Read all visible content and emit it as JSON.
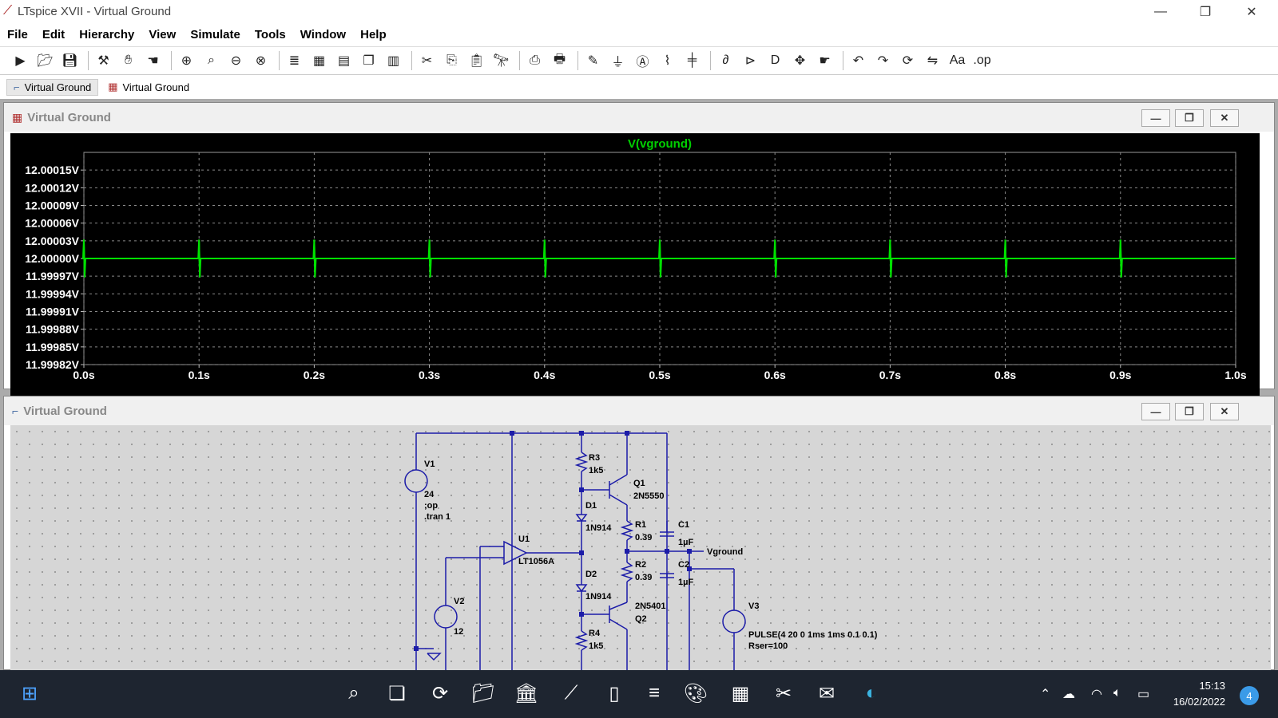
{
  "window": {
    "title": "LTspice XVII - Virtual Ground",
    "minimize": "—",
    "maximize": "❐",
    "close": "✕"
  },
  "menu": [
    "File",
    "Edit",
    "Hierarchy",
    "View",
    "Simulate",
    "Tools",
    "Window",
    "Help"
  ],
  "toolbar_icons": [
    "run-icon",
    "open-icon",
    "save-icon",
    "control-panel-icon",
    "halt-icon",
    "pan-hand-icon",
    "zoom-in-icon",
    "zoom-area-icon",
    "zoom-out-icon",
    "zoom-fit-icon",
    "autorange-icon",
    "grid-icon",
    "tile-horizontal-icon",
    "cascade-icon",
    "tile-vertical-icon",
    "cut-icon",
    "copy-icon",
    "paste-icon",
    "find-icon",
    "print-setup-icon",
    "print-icon",
    "wire-icon",
    "ground-icon",
    "label-net-icon",
    "resistor-icon",
    "capacitor-icon",
    "inductor-icon",
    "diode-icon",
    "component-icon",
    "move-icon",
    "drag-icon",
    "undo-icon",
    "redo-icon",
    "rotate-icon",
    "mirror-icon",
    "text-icon",
    "spice-directive-icon"
  ],
  "doc_tabs": [
    {
      "label": "Virtual Ground",
      "icon": "schematic-icon"
    },
    {
      "label": "Virtual Ground",
      "icon": "waveform-icon"
    }
  ],
  "plot_window": {
    "title": "Virtual Ground",
    "trace_label": "V(vground)"
  },
  "schematic_window": {
    "title": "Virtual Ground"
  },
  "schematic": {
    "labels": {
      "v1": "V1",
      "v1_value": "24",
      "op": ";op",
      "tran": ".tran 1",
      "v2": "V2",
      "v2_value": "12",
      "u1": "U1",
      "u1_part": "LT1056A",
      "r3": "R3",
      "r3_value": "1k5",
      "q1": "Q1",
      "q1_part": "2N5550",
      "d1": "D1",
      "d1_part": "1N914",
      "r1": "R1",
      "r1_value": "0.39",
      "c1": "C1",
      "c1_value": "1µF",
      "r2": "R2",
      "r2_value": "0.39",
      "c2": "C2",
      "c2_value": "1µF",
      "d2": "D2",
      "d2_part": "1N914",
      "q2_part": "2N5401",
      "q2": "Q2",
      "r4": "R4",
      "r4_value": "1k5",
      "net_vground": "Vground",
      "v3": "V3",
      "v3_pulse": "PULSE(4 20 0 1ms 1ms 0.1 0.1)",
      "v3_rser": "Rser=100"
    }
  },
  "chart_data": {
    "type": "line",
    "title": "V(vground)",
    "xlabel": "",
    "ylabel": "",
    "xlim": [
      0.0,
      1.0
    ],
    "ylim": [
      11.99982,
      12.00018
    ],
    "x_ticks": [
      "0.0s",
      "0.1s",
      "0.2s",
      "0.3s",
      "0.4s",
      "0.5s",
      "0.6s",
      "0.7s",
      "0.8s",
      "0.9s",
      "1.0s"
    ],
    "x_tick_values": [
      0.0,
      0.1,
      0.2,
      0.3,
      0.4,
      0.5,
      0.6,
      0.7,
      0.8,
      0.9,
      1.0
    ],
    "y_ticks": [
      "12.00015V",
      "12.00012V",
      "12.00009V",
      "12.00006V",
      "12.00003V",
      "12.00000V",
      "11.99997V",
      "11.99994V",
      "11.99991V",
      "11.99988V",
      "11.99985V",
      "11.99982V"
    ],
    "y_tick_values": [
      12.00015,
      12.00012,
      12.00009,
      12.00006,
      12.00003,
      12.0,
      11.99997,
      11.99994,
      11.99991,
      11.99988,
      11.99985,
      11.99982
    ],
    "grid": true,
    "series": [
      {
        "color": "#00e000",
        "baseline": 12.0,
        "spike_times": [
          0.0,
          0.1,
          0.2,
          0.3,
          0.4,
          0.5,
          0.6,
          0.7,
          0.8,
          0.9
        ],
        "spike_high": 12.000032,
        "spike_low": 11.999968
      }
    ]
  },
  "taskbar": {
    "icons": [
      "start-icon",
      "search-icon",
      "task-view-icon",
      "refresh-icon",
      "file-explorer-icon",
      "library-icon",
      "ltspice-icon",
      "notepad-icon",
      "notes-icon",
      "paint-icon",
      "calculator-icon",
      "snipping-tool-icon",
      "mail-icon",
      "edge-icon"
    ],
    "time": "15:13",
    "date": "16/02/2022",
    "notifications": "4"
  }
}
